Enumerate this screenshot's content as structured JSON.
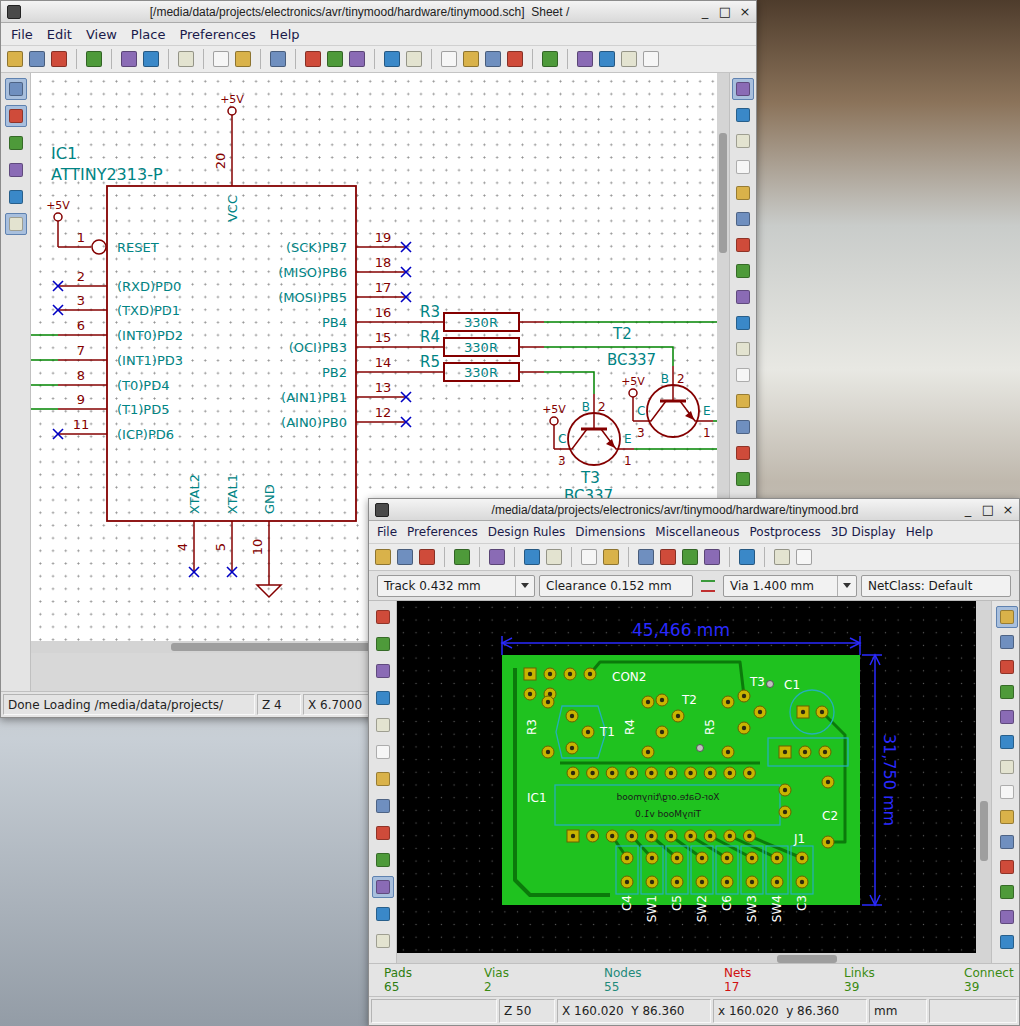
{
  "schematic_window": {
    "title": "[/media/data/projects/electronics/avr/tinymood/hardware/tinymood.sch]  Sheet /",
    "controls": [
      "_",
      "□",
      "×"
    ],
    "menus": [
      "File",
      "Edit",
      "View",
      "Place",
      "Preferences",
      "Help"
    ],
    "left_tools": [
      {
        "selected": true
      },
      {
        "selected": true
      },
      {
        "selected": false
      },
      {
        "selected": false
      },
      {
        "selected": false
      },
      {
        "selected": true
      }
    ],
    "right_tools": [
      {
        "selected": true
      },
      {
        "selected": false
      },
      {
        "selected": false
      },
      {
        "selected": false
      },
      {
        "selected": false
      },
      {
        "selected": false
      },
      {
        "selected": false
      },
      {
        "selected": false
      },
      {
        "selected": false
      },
      {
        "selected": false
      },
      {
        "selected": false
      },
      {
        "selected": false
      },
      {
        "selected": false
      },
      {
        "selected": false
      },
      {
        "selected": false
      },
      {
        "selected": false
      },
      {
        "selected": false
      }
    ],
    "status": [
      "Done Loading /media/data/projects/",
      "Z 4",
      "X 6.7000"
    ]
  },
  "schematic": {
    "ic": {
      "ref": "IC1",
      "value": "ATTINY2313-P",
      "top_pin": {
        "num": "20",
        "name": "VCC",
        "power": "+5V"
      },
      "left_pins": [
        {
          "num": "1",
          "name": "RESET",
          "inverted": true,
          "kind": "power",
          "power": "+5V"
        },
        {
          "num": "2",
          "name": "(RXD)PD0",
          "inverted": false,
          "kind": "nc"
        },
        {
          "num": "3",
          "name": "(TXD)PD1",
          "inverted": false,
          "kind": "nc"
        },
        {
          "num": "6",
          "name": "(INT0)PD2",
          "inverted": false,
          "kind": "wire"
        },
        {
          "num": "7",
          "name": "(INT1)PD3",
          "inverted": false,
          "kind": "wire"
        },
        {
          "num": "8",
          "name": "(T0)PD4",
          "inverted": false,
          "kind": "wire"
        },
        {
          "num": "9",
          "name": "(T1)PD5",
          "inverted": false,
          "kind": "wire"
        },
        {
          "num": "11",
          "name": "(ICP)PD6",
          "inverted": false,
          "kind": "nc"
        }
      ],
      "right_pins": [
        {
          "num": "19",
          "name": "(SCK)PB7",
          "kind": "nc"
        },
        {
          "num": "18",
          "name": "(MISO)PB6",
          "kind": "nc"
        },
        {
          "num": "17",
          "name": "(MOSI)PB5",
          "kind": "nc"
        },
        {
          "num": "16",
          "name": "PB4",
          "kind": "resistor"
        },
        {
          "num": "15",
          "name": "(OCI)PB3",
          "kind": "resistor"
        },
        {
          "num": "14",
          "name": "PB2",
          "kind": "resistor"
        },
        {
          "num": "13",
          "name": "(AIN1)PB1",
          "kind": "nc"
        },
        {
          "num": "12",
          "name": "(AIN0)PB0",
          "kind": "nc"
        }
      ],
      "bottom_pins": [
        {
          "num": "4",
          "name": "XTAL2",
          "kind": "nc"
        },
        {
          "num": "5",
          "name": "XTAL1",
          "kind": "nc"
        },
        {
          "num": "10",
          "name": "GND",
          "kind": "ground"
        }
      ]
    },
    "resistors": [
      {
        "ref": "R3",
        "value": "330R"
      },
      {
        "ref": "R4",
        "value": "330R"
      },
      {
        "ref": "R5",
        "value": "330R"
      }
    ],
    "transistors": [
      {
        "ref": "T2",
        "value": "BC337",
        "power": "+5V",
        "pins": [
          {
            "name": "B",
            "num": "2"
          },
          {
            "name": "C",
            "num": "3"
          },
          {
            "name": "E",
            "num": "1"
          }
        ]
      },
      {
        "ref": "T3",
        "value": "BC337",
        "power": "+5V",
        "pins": [
          {
            "name": "B",
            "num": "2"
          },
          {
            "name": "C",
            "num": "3"
          },
          {
            "name": "E",
            "num": "1"
          }
        ]
      }
    ]
  },
  "pcb_window": {
    "title": "/media/data/projects/electronics/avr/tinymood/hardware/tinymood.brd",
    "controls": [
      "_",
      "□",
      "×"
    ],
    "menus": [
      "File",
      "Preferences",
      "Design Rules",
      "Dimensions",
      "Miscellaneous",
      "Postprocess",
      "3D Display",
      "Help"
    ],
    "options": [
      {
        "kind": "dropdown",
        "text": "Track 0.432 mm"
      },
      {
        "kind": "field",
        "text": "Clearance 0.152 mm"
      },
      {
        "kind": "icon"
      },
      {
        "kind": "dropdown",
        "text": "Via 1.400 mm"
      },
      {
        "kind": "field",
        "text": "NetClass: Default"
      }
    ],
    "left_tools": [
      {
        "selected": false
      },
      {
        "selected": false
      },
      {
        "selected": false
      },
      {
        "selected": false
      },
      {
        "selected": false
      },
      {
        "selected": false
      },
      {
        "selected": false
      },
      {
        "selected": false
      },
      {
        "selected": false
      },
      {
        "selected": false
      },
      {
        "selected": true
      },
      {
        "selected": false
      },
      {
        "selected": false
      }
    ],
    "right_tools": [
      {
        "selected": true
      },
      {
        "selected": false
      },
      {
        "selected": false
      },
      {
        "selected": false
      },
      {
        "selected": false
      },
      {
        "selected": false
      },
      {
        "selected": false
      },
      {
        "selected": false
      },
      {
        "selected": false
      },
      {
        "selected": false
      },
      {
        "selected": false
      },
      {
        "selected": false
      },
      {
        "selected": false
      },
      {
        "selected": false
      }
    ],
    "stats": [
      {
        "label": "Pads",
        "value": "65",
        "color": "#2e7d10"
      },
      {
        "label": "Vias",
        "value": "2",
        "color": "#3a8a12"
      },
      {
        "label": "Nodes",
        "value": "55",
        "color": "#1f8a7a"
      },
      {
        "label": "Nets",
        "value": "17",
        "color": "#d01010"
      },
      {
        "label": "Links",
        "value": "39",
        "color": "#3a8a12"
      },
      {
        "label": "Connect",
        "value": "39",
        "color": "#3a8a12"
      }
    ],
    "status": [
      "Z 50",
      "X 160.020  Y 86.360",
      "x 160.020  y 86.360",
      "mm"
    ]
  },
  "pcb": {
    "width_dim": "45,466 mm",
    "height_dim": "31,750 mm",
    "labels": [
      "CON2",
      "R3",
      "T1",
      "R4",
      "T2",
      "R5",
      "T3",
      "C1",
      "IC1",
      "C2",
      "J1"
    ],
    "bottom_labels": [
      "C4",
      "SW1",
      "C5",
      "SW2",
      "C6",
      "SW3",
      "SW4",
      "C3"
    ],
    "silkscreen": [
      "Xor-Gate.org/tinymood",
      "TinyMood v1.0"
    ]
  }
}
